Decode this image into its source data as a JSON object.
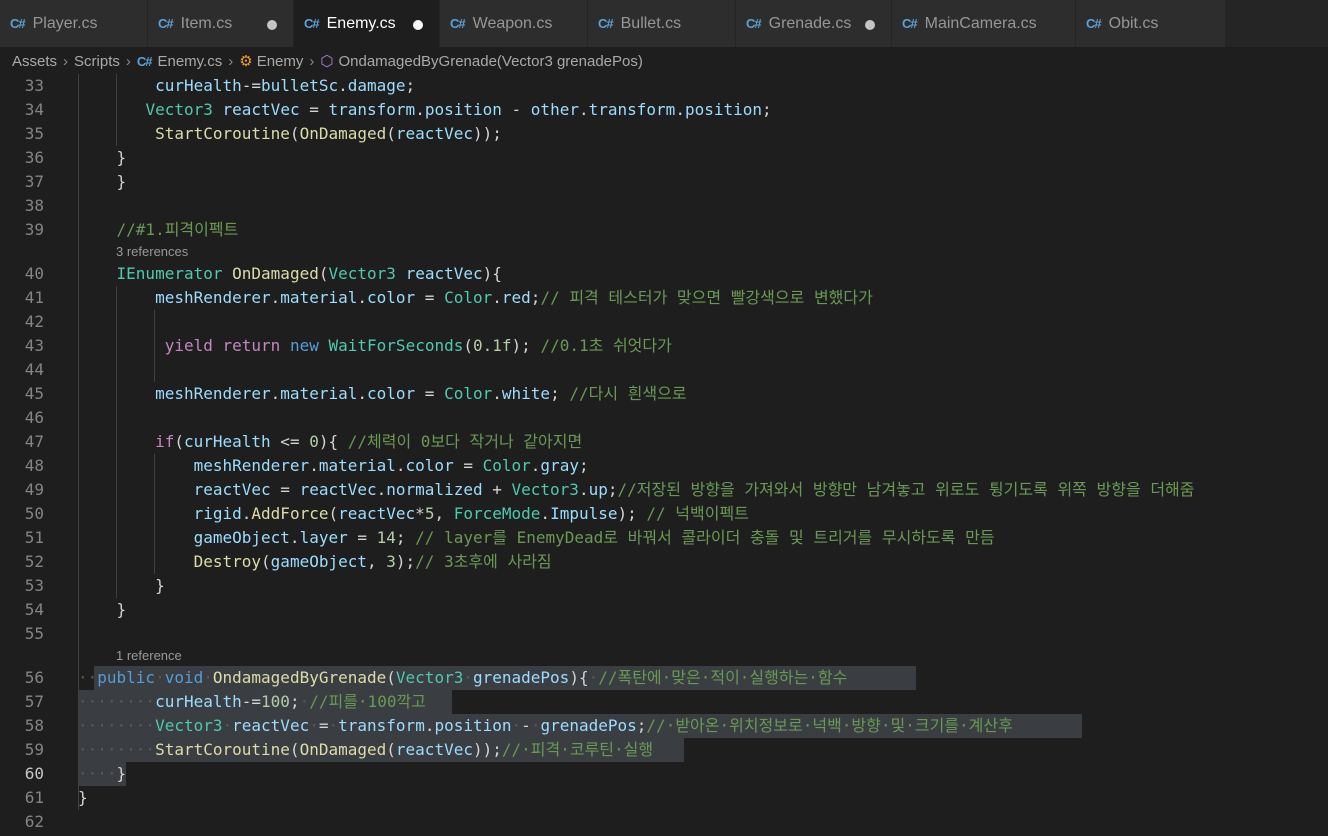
{
  "tabs": [
    {
      "label": "Player.cs",
      "modified": false,
      "active": false
    },
    {
      "label": "Item.cs",
      "modified": true,
      "active": false
    },
    {
      "label": "Enemy.cs",
      "modified": true,
      "active": true
    },
    {
      "label": "Weapon.cs",
      "modified": false,
      "active": false
    },
    {
      "label": "Bullet.cs",
      "modified": false,
      "active": false
    },
    {
      "label": "Grenade.cs",
      "modified": true,
      "active": false
    },
    {
      "label": "MainCamera.cs",
      "modified": false,
      "active": false
    },
    {
      "label": "Obit.cs",
      "modified": false,
      "active": false
    }
  ],
  "breadcrumb": {
    "assets": "Assets",
    "scripts": "Scripts",
    "file": "Enemy.cs",
    "class": "Enemy",
    "method": "OndamagedByGrenade(Vector3 grenadePos)"
  },
  "icons": {
    "cs": "csharp-icon",
    "class": "class-icon",
    "method": "method-icon"
  },
  "colors": {
    "keyword": "#569cd6",
    "type": "#4ec9b0",
    "function": "#dcdcaa",
    "variable": "#9cdcfe",
    "comment": "#6a9955",
    "number": "#b5cea8",
    "control": "#c586c0"
  },
  "cursor_line": 60,
  "codelens": {
    "before_40": "3 references",
    "before_56": "1 reference"
  },
  "lines": [
    {
      "n": 33,
      "tokens": [
        [
          "",
          "        "
        ],
        [
          "vr",
          "curHealth"
        ],
        [
          "",
          "-="
        ],
        [
          "vr",
          "bulletSc"
        ],
        [
          "",
          "."
        ],
        [
          "vr",
          "damage"
        ],
        [
          "",
          ";"
        ]
      ]
    },
    {
      "n": 34,
      "tokens": [
        [
          "",
          "       "
        ],
        [
          "ty",
          "Vector3"
        ],
        [
          "",
          " "
        ],
        [
          "vr",
          "reactVec"
        ],
        [
          "",
          " = "
        ],
        [
          "vr",
          "transform"
        ],
        [
          "",
          "."
        ],
        [
          "vr",
          "position"
        ],
        [
          "",
          " - "
        ],
        [
          "vr",
          "other"
        ],
        [
          "",
          "."
        ],
        [
          "vr",
          "transform"
        ],
        [
          "",
          "."
        ],
        [
          "vr",
          "position"
        ],
        [
          "",
          ";"
        ]
      ]
    },
    {
      "n": 35,
      "tokens": [
        [
          "",
          "        "
        ],
        [
          "fn",
          "StartCoroutine"
        ],
        [
          "",
          "("
        ],
        [
          "fn",
          "OnDamaged"
        ],
        [
          "",
          "("
        ],
        [
          "vr",
          "reactVec"
        ],
        [
          "",
          "));"
        ]
      ]
    },
    {
      "n": 36,
      "tokens": [
        [
          "",
          "    }"
        ]
      ]
    },
    {
      "n": 37,
      "tokens": [
        [
          "",
          "    }"
        ]
      ]
    },
    {
      "n": 38,
      "tokens": []
    },
    {
      "n": 39,
      "tokens": [
        [
          "",
          "    "
        ],
        [
          "cm",
          "//#1.피격이펙트"
        ]
      ]
    },
    {
      "n": 40,
      "tokens": [
        [
          "",
          "    "
        ],
        [
          "ty",
          "IEnumerator"
        ],
        [
          "",
          " "
        ],
        [
          "fn",
          "OnDamaged"
        ],
        [
          "",
          "("
        ],
        [
          "ty",
          "Vector3"
        ],
        [
          "",
          " "
        ],
        [
          "vr",
          "reactVec"
        ],
        [
          "",
          "){"
        ]
      ]
    },
    {
      "n": 41,
      "tokens": [
        [
          "",
          "        "
        ],
        [
          "vr",
          "meshRenderer"
        ],
        [
          "",
          "."
        ],
        [
          "vr",
          "material"
        ],
        [
          "",
          "."
        ],
        [
          "vr",
          "color"
        ],
        [
          "",
          " = "
        ],
        [
          "ty",
          "Color"
        ],
        [
          "",
          "."
        ],
        [
          "vr",
          "red"
        ],
        [
          "",
          ";"
        ],
        [
          "cm",
          "// 피격 테스터가 맞으면 빨강색으로 변했다가"
        ]
      ]
    },
    {
      "n": 42,
      "tokens": []
    },
    {
      "n": 43,
      "tokens": [
        [
          "",
          "         "
        ],
        [
          "ctl",
          "yield"
        ],
        [
          "",
          " "
        ],
        [
          "ctl",
          "return"
        ],
        [
          "",
          " "
        ],
        [
          "kw",
          "new"
        ],
        [
          "",
          " "
        ],
        [
          "ty",
          "WaitForSeconds"
        ],
        [
          "",
          "("
        ],
        [
          "nm",
          "0.1f"
        ],
        [
          "",
          "); "
        ],
        [
          "cm",
          "//0.1초 쉬엇다가"
        ]
      ]
    },
    {
      "n": 44,
      "tokens": []
    },
    {
      "n": 45,
      "tokens": [
        [
          "",
          "        "
        ],
        [
          "vr",
          "meshRenderer"
        ],
        [
          "",
          "."
        ],
        [
          "vr",
          "material"
        ],
        [
          "",
          "."
        ],
        [
          "vr",
          "color"
        ],
        [
          "",
          " = "
        ],
        [
          "ty",
          "Color"
        ],
        [
          "",
          "."
        ],
        [
          "vr",
          "white"
        ],
        [
          "",
          "; "
        ],
        [
          "cm",
          "//다시 흰색으로"
        ]
      ]
    },
    {
      "n": 46,
      "tokens": []
    },
    {
      "n": 47,
      "tokens": [
        [
          "",
          "        "
        ],
        [
          "ctl",
          "if"
        ],
        [
          "",
          "("
        ],
        [
          "vr",
          "curHealth"
        ],
        [
          "",
          " <= "
        ],
        [
          "nm",
          "0"
        ],
        [
          "",
          "){ "
        ],
        [
          "cm",
          "//체력이 0보다 작거나 같아지면"
        ]
      ]
    },
    {
      "n": 48,
      "tokens": [
        [
          "",
          "            "
        ],
        [
          "vr",
          "meshRenderer"
        ],
        [
          "",
          "."
        ],
        [
          "vr",
          "material"
        ],
        [
          "",
          "."
        ],
        [
          "vr",
          "color"
        ],
        [
          "",
          " = "
        ],
        [
          "ty",
          "Color"
        ],
        [
          "",
          "."
        ],
        [
          "vr",
          "gray"
        ],
        [
          "",
          ";"
        ]
      ]
    },
    {
      "n": 49,
      "tokens": [
        [
          "",
          "            "
        ],
        [
          "vr",
          "reactVec"
        ],
        [
          "",
          " = "
        ],
        [
          "vr",
          "reactVec"
        ],
        [
          "",
          "."
        ],
        [
          "vr",
          "normalized"
        ],
        [
          "",
          " + "
        ],
        [
          "ty",
          "Vector3"
        ],
        [
          "",
          "."
        ],
        [
          "vr",
          "up"
        ],
        [
          "",
          ";"
        ],
        [
          "cm",
          "//저장된 방향을 가져와서 방향만 남겨놓고 위로도 튕기도록 위쪽 방향을 더해줌"
        ]
      ]
    },
    {
      "n": 50,
      "tokens": [
        [
          "",
          "            "
        ],
        [
          "vr",
          "rigid"
        ],
        [
          "",
          "."
        ],
        [
          "fn",
          "AddForce"
        ],
        [
          "",
          "("
        ],
        [
          "vr",
          "reactVec"
        ],
        [
          "",
          "*"
        ],
        [
          "nm",
          "5"
        ],
        [
          "",
          ", "
        ],
        [
          "ty",
          "ForceMode"
        ],
        [
          "",
          "."
        ],
        [
          "vr",
          "Impulse"
        ],
        [
          "",
          "); "
        ],
        [
          "cm",
          "// 넉백이펙트"
        ]
      ]
    },
    {
      "n": 51,
      "tokens": [
        [
          "",
          "            "
        ],
        [
          "vr",
          "gameObject"
        ],
        [
          "",
          "."
        ],
        [
          "vr",
          "layer"
        ],
        [
          "",
          " = "
        ],
        [
          "nm",
          "14"
        ],
        [
          "",
          "; "
        ],
        [
          "cm",
          "// layer를 EnemyDead로 바꿔서 콜라이더 충돌 및 트리거를 무시하도록 만듬"
        ]
      ]
    },
    {
      "n": 52,
      "tokens": [
        [
          "",
          "            "
        ],
        [
          "fn",
          "Destroy"
        ],
        [
          "",
          "("
        ],
        [
          "vr",
          "gameObject"
        ],
        [
          "",
          ", "
        ],
        [
          "nm",
          "3"
        ],
        [
          "",
          ");"
        ],
        [
          "cm",
          "// 3초후에 사라짐"
        ]
      ]
    },
    {
      "n": 53,
      "tokens": [
        [
          "",
          "        }"
        ]
      ]
    },
    {
      "n": 54,
      "tokens": [
        [
          "",
          "    }"
        ]
      ]
    },
    {
      "n": 55,
      "tokens": []
    },
    {
      "n": 56,
      "tokens": [
        [
          "ws",
          "··"
        ],
        [
          "kw",
          "public"
        ],
        [
          "ws",
          "·"
        ],
        [
          "kw",
          "void"
        ],
        [
          "ws",
          "·"
        ],
        [
          "fn",
          "OndamagedByGrenade"
        ],
        [
          "",
          "("
        ],
        [
          "ty",
          "Vector3"
        ],
        [
          "ws",
          "·"
        ],
        [
          "vr",
          "grenadePos"
        ],
        [
          "",
          "){"
        ],
        [
          "ws",
          "·"
        ],
        [
          "cm",
          "//폭탄에·맞은·적이·실행하는·함수"
        ]
      ]
    },
    {
      "n": 57,
      "tokens": [
        [
          "ws",
          "········"
        ],
        [
          "vr",
          "curHealth"
        ],
        [
          "",
          "-="
        ],
        [
          "nm",
          "100"
        ],
        [
          "",
          ";"
        ],
        [
          "ws",
          "·"
        ],
        [
          "cm",
          "//피를·100깍고"
        ]
      ]
    },
    {
      "n": 58,
      "tokens": [
        [
          "ws",
          "········"
        ],
        [
          "ty",
          "Vector3"
        ],
        [
          "ws",
          "·"
        ],
        [
          "vr",
          "reactVec"
        ],
        [
          "ws",
          "·"
        ],
        [
          "",
          "="
        ],
        [
          "ws",
          "·"
        ],
        [
          "vr",
          "transform"
        ],
        [
          "",
          "."
        ],
        [
          "vr",
          "position"
        ],
        [
          "ws",
          "·"
        ],
        [
          "",
          "-"
        ],
        [
          "ws",
          "·"
        ],
        [
          "vr",
          "grenadePos"
        ],
        [
          "",
          ";"
        ],
        [
          "cm",
          "//·받아온·위치정보로·넉백·방향·및·크기를·계산후"
        ]
      ]
    },
    {
      "n": 59,
      "tokens": [
        [
          "ws",
          "········"
        ],
        [
          "fn",
          "StartCoroutine"
        ],
        [
          "",
          "("
        ],
        [
          "fn",
          "OnDamaged"
        ],
        [
          "",
          "("
        ],
        [
          "vr",
          "reactVec"
        ],
        [
          "",
          "));"
        ],
        [
          "cm",
          "//·피격·코루틴·실행"
        ]
      ]
    },
    {
      "n": 60,
      "tokens": [
        [
          "ws",
          "····"
        ],
        [
          "",
          "}"
        ]
      ]
    },
    {
      "n": 61,
      "tokens": [
        [
          "",
          "}"
        ]
      ]
    },
    {
      "n": 62,
      "tokens": []
    }
  ]
}
